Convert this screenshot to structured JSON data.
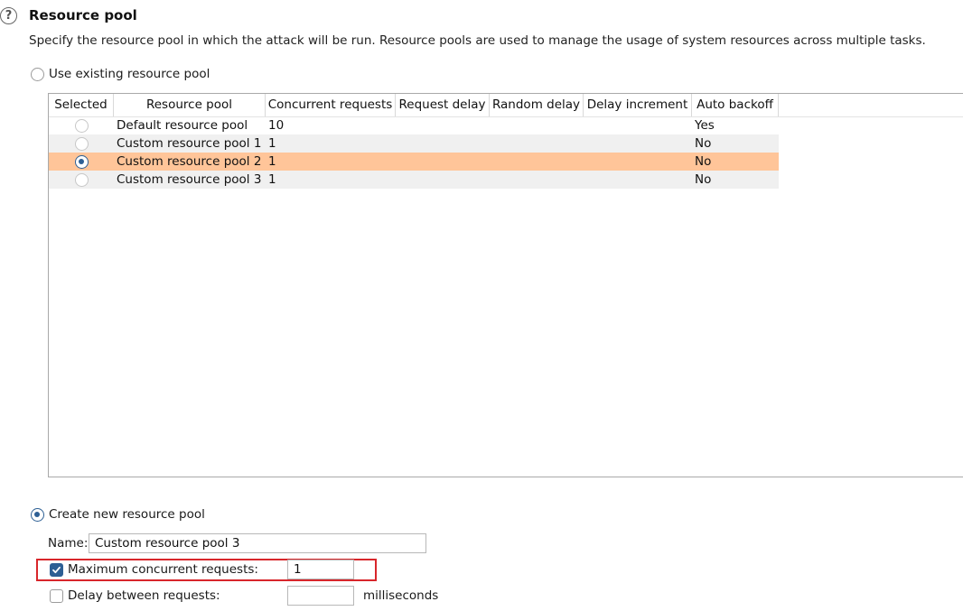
{
  "section": {
    "title": "Resource pool",
    "description": "Specify the resource pool in which the attack will be run. Resource pools are used to manage the usage of system resources across multiple tasks."
  },
  "options": {
    "use_existing_label": "Use existing resource pool",
    "use_existing_selected": false,
    "create_new_label": "Create new resource pool",
    "create_new_selected": true
  },
  "table": {
    "columns": [
      "Selected",
      "Resource pool",
      "Concurrent requests",
      "Request delay",
      "Random delay",
      "Delay increment",
      "Auto backoff"
    ],
    "rows": [
      {
        "selected": false,
        "pool": "Default resource pool",
        "concurrent": "10",
        "request_delay": "",
        "random_delay": "",
        "delay_increment": "",
        "auto_backoff": "Yes"
      },
      {
        "selected": false,
        "pool": "Custom resource pool 1",
        "concurrent": "1",
        "request_delay": "",
        "random_delay": "",
        "delay_increment": "",
        "auto_backoff": "No"
      },
      {
        "selected": true,
        "pool": "Custom resource pool 2",
        "concurrent": "1",
        "request_delay": "",
        "random_delay": "",
        "delay_increment": "",
        "auto_backoff": "No"
      },
      {
        "selected": false,
        "pool": "Custom resource pool 3",
        "concurrent": "1",
        "request_delay": "",
        "random_delay": "",
        "delay_increment": "",
        "auto_backoff": "No"
      }
    ]
  },
  "form": {
    "name_label": "Name:",
    "name_value": "Custom resource pool 3",
    "max_concurrent_label": "Maximum concurrent requests:",
    "max_concurrent_checked": true,
    "max_concurrent_value": "1",
    "delay_label": "Delay between requests:",
    "delay_checked": false,
    "delay_value": "",
    "delay_unit": "milliseconds"
  },
  "colors": {
    "accent": "#2d5f94",
    "selected_row": "#ffc599",
    "highlight_border": "#d8262b"
  },
  "icons": {
    "help": "question-circle"
  }
}
